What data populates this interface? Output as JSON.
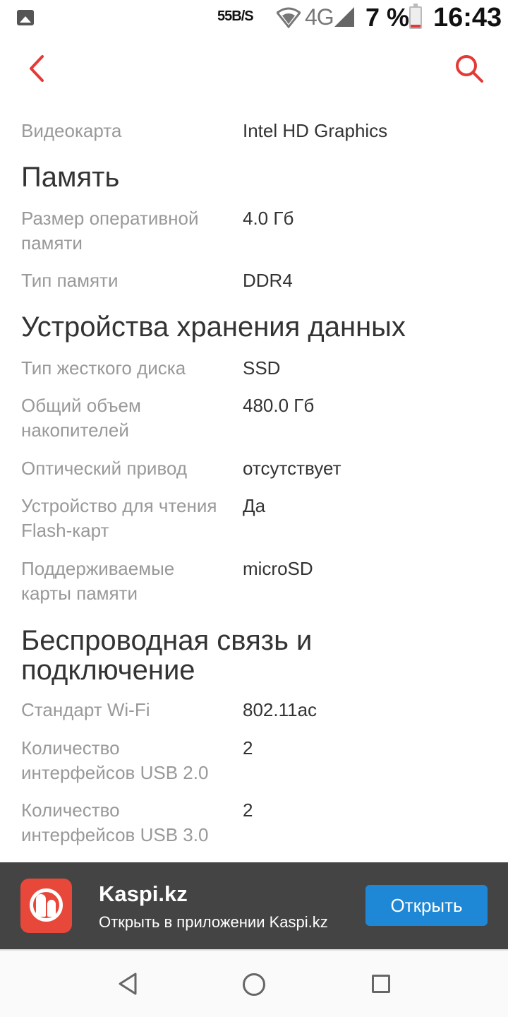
{
  "status_bar": {
    "speed": "55B/S",
    "network": "4G",
    "battery_percent": "7 %",
    "time": "16:43"
  },
  "app_bar": {
    "back_icon": "chevron-left-icon",
    "search_icon": "search-icon",
    "accent_color": "#e53935"
  },
  "sections": {
    "video": {
      "label": "Видеокарта",
      "value": "Intel HD Graphics"
    },
    "memory": {
      "title": "Память",
      "rows": [
        {
          "label": "Размер оперативной памяти",
          "value": "4.0 Гб"
        },
        {
          "label": "Тип памяти",
          "value": "DDR4"
        }
      ]
    },
    "storage": {
      "title": "Устройства хранения данных",
      "rows": [
        {
          "label": "Тип жесткого диска",
          "value": "SSD"
        },
        {
          "label": "Общий объем накопителей",
          "value": "480.0 Гб"
        },
        {
          "label": "Оптический привод",
          "value": "отсутствует"
        },
        {
          "label": "Устройство для чтения Flash-карт",
          "value": "Да"
        },
        {
          "label": "Поддерживаемые карты памяти",
          "value": "microSD"
        }
      ]
    },
    "wireless": {
      "title": "Беспроводная связь и подключение",
      "rows": [
        {
          "label": "Стандарт Wi-Fi",
          "value": "802.11ac"
        },
        {
          "label": "Количество интерфейсов USB 2.0",
          "value": "2"
        },
        {
          "label": "Количество интерфейсов USB 3.0",
          "value": "2"
        }
      ]
    }
  },
  "banner": {
    "title": "Kaspi.kz",
    "subtitle": "Открыть в приложении Kaspi.kz",
    "button": "Открыть",
    "button_color": "#1f88d6",
    "logo_color": "#e8483a"
  },
  "nav_bar": {
    "back": "triangle-back-icon",
    "home": "circle-home-icon",
    "recent": "square-recents-icon"
  }
}
